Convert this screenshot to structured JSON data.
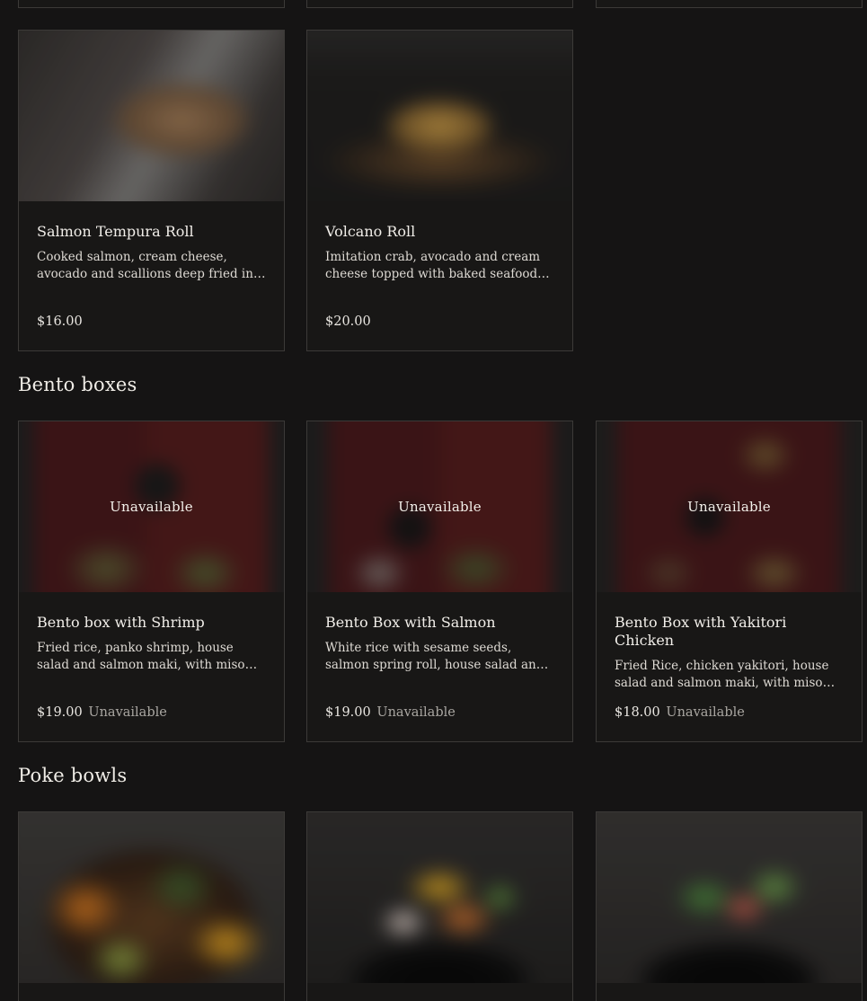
{
  "sections": [
    {
      "title": "",
      "items": [
        {
          "name": "Salmon Tempura Roll",
          "description": "Cooked salmon, cream cheese, avocado and scallions deep fried in tempura batter",
          "price": "$16.00",
          "available": true
        },
        {
          "name": "Volcano Roll",
          "description": "Imitation crab, avocado and cream cheese topped with baked seafood mix",
          "price": "$20.00",
          "available": true
        }
      ]
    },
    {
      "title": "Bento boxes",
      "items": [
        {
          "name": "Bento box with Shrimp",
          "description": "Fried rice, panko shrimp, house salad and salmon maki, with miso soup on the side",
          "price": "$19.00",
          "status": "Unavailable",
          "overlay": "Unavailable",
          "available": false
        },
        {
          "name": "Bento Box with Salmon",
          "description": "White rice with sesame seeds, salmon spring roll, house salad and salmon maki",
          "price": "$19.00",
          "status": "Unavailable",
          "overlay": "Unavailable",
          "available": false
        },
        {
          "name": "Bento Box with Yakitori Chicken",
          "description": "Fried Rice, chicken yakitori, house salad and salmon maki, with miso soup",
          "price": "$18.00",
          "status": "Unavailable",
          "overlay": "Unavailable",
          "available": false
        }
      ]
    },
    {
      "title": "Poke bowls",
      "items": [
        {
          "available": true
        },
        {
          "available": true
        },
        {
          "available": true
        }
      ]
    }
  ],
  "colors": {
    "background": "#151414",
    "card_border": "#3c3a38",
    "text": "#e9e6e1",
    "unavailable_text": "#a9a6a1"
  }
}
